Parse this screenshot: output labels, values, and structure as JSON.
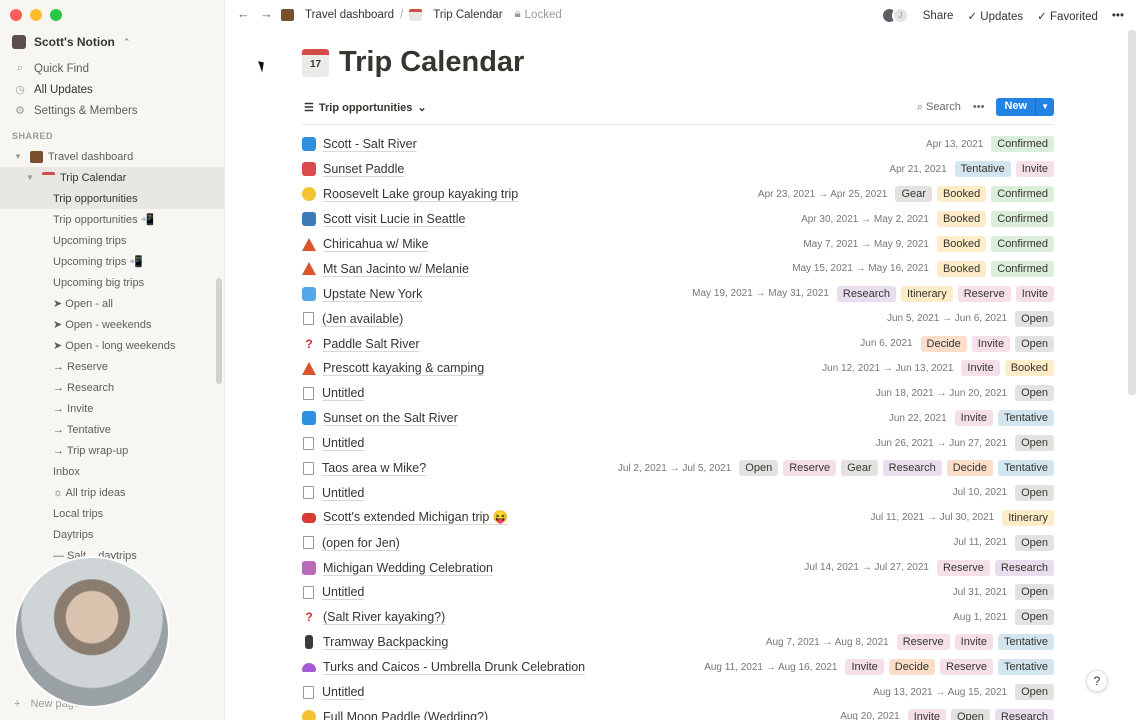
{
  "workspace": {
    "name": "Scott's Notion"
  },
  "sidebar": {
    "nav": [
      {
        "icon": "search-icon",
        "label": "Quick Find"
      },
      {
        "icon": "clock-icon",
        "label": "All Updates"
      },
      {
        "icon": "gear-icon",
        "label": "Settings & Members"
      }
    ],
    "shared_heading": "SHARED",
    "tree": [
      {
        "label": "Travel dashboard",
        "level": 1
      },
      {
        "label": "Trip Calendar",
        "level": 2
      },
      {
        "label": "Trip opportunities",
        "level": 3
      },
      {
        "label": "Trip opportunities 📲",
        "level": 3
      },
      {
        "label": "Upcoming trips",
        "level": 3
      },
      {
        "label": "Upcoming trips 📲",
        "level": 3
      },
      {
        "label": "Upcoming big trips",
        "level": 3
      },
      {
        "label": "➤ Open - all",
        "level": 3
      },
      {
        "label": "➤ Open - weekends",
        "level": 3
      },
      {
        "label": "➤ Open - long weekends",
        "level": 3
      },
      {
        "label": "→ Reserve",
        "level": 3
      },
      {
        "label": "→ Research",
        "level": 3
      },
      {
        "label": "→ Invite",
        "level": 3
      },
      {
        "label": "→ Tentative",
        "level": 3
      },
      {
        "label": "→ Trip wrap-up",
        "level": 3
      },
      {
        "label": "Inbox",
        "level": 3
      },
      {
        "label": "☼ All trip ideas",
        "level": 3
      },
      {
        "label": "Local trips",
        "level": 3
      },
      {
        "label": "Daytrips",
        "level": 3
      },
      {
        "label": "— Salt... daytrips",
        "level": 3
      }
    ],
    "new_page": "New page",
    "trips_fragment": "trips"
  },
  "topbar": {
    "breadcrumb_parent": "Travel dashboard",
    "breadcrumb_current": "Trip Calendar",
    "locked": "Locked",
    "share": "Share",
    "updates": "Updates",
    "favorited": "Favorited"
  },
  "page": {
    "title": "Trip Calendar",
    "title_icon_text": "17",
    "view_name": "Trip opportunities",
    "search_label": "Search",
    "new_label": "New"
  },
  "rows": [
    {
      "icon": "i-blue",
      "name": "Scott - Salt River",
      "date": "Apr 13, 2021",
      "tags": [
        "Confirmed"
      ]
    },
    {
      "icon": "i-red",
      "name": "Sunset Paddle",
      "date": "Apr 21, 2021",
      "tags": [
        "Tentative",
        "Invite"
      ]
    },
    {
      "icon": "i-sun",
      "name": "Roosevelt Lake group kayaking trip",
      "date": "Apr 23, 2021 → Apr 25, 2021",
      "tags": [
        "Gear",
        "Booked",
        "Confirmed"
      ]
    },
    {
      "icon": "i-city",
      "name": "Scott visit Lucie in Seattle",
      "date": "Apr 30, 2021 → May 2, 2021",
      "tags": [
        "Booked",
        "Confirmed"
      ]
    },
    {
      "icon": "i-tent",
      "name": "Chiricahua w/ Mike",
      "date": "May 7, 2021 → May 9, 2021",
      "tags": [
        "Booked",
        "Confirmed"
      ]
    },
    {
      "icon": "i-tent",
      "name": "Mt San Jacinto w/ Melanie",
      "date": "May 15, 2021 → May 16, 2021",
      "tags": [
        "Booked",
        "Confirmed"
      ]
    },
    {
      "icon": "i-plane",
      "name": "Upstate New York",
      "date": "May 19, 2021 → May 31, 2021",
      "tags": [
        "Research",
        "Itinerary",
        "Reserve",
        "Invite"
      ]
    },
    {
      "icon": "i-doc",
      "name": "(Jen available)",
      "date": "Jun 5, 2021 → Jun 6, 2021",
      "tags": [
        "Open"
      ]
    },
    {
      "icon": "i-q",
      "name": "Paddle Salt River",
      "date": "Jun 6, 2021",
      "tags": [
        "Decide",
        "Invite",
        "Open"
      ]
    },
    {
      "icon": "i-tent",
      "name": "Prescott kayaking & camping",
      "date": "Jun 12, 2021 → Jun 13, 2021",
      "tags": [
        "Invite",
        "Booked"
      ]
    },
    {
      "icon": "i-doc",
      "name": "Untitled",
      "date": "Jun 18, 2021 → Jun 20, 2021",
      "tags": [
        "Open"
      ]
    },
    {
      "icon": "i-blue",
      "name": "Sunset on the Salt River",
      "date": "Jun 22, 2021",
      "tags": [
        "Invite",
        "Tentative"
      ]
    },
    {
      "icon": "i-doc",
      "name": "Untitled",
      "date": "Jun 26, 2021 → Jun 27, 2021",
      "tags": [
        "Open"
      ]
    },
    {
      "icon": "i-doc",
      "name": "Taos area w Mike?",
      "date": "Jul 2, 2021 → Jul 5, 2021",
      "tags": [
        "Open",
        "Reserve",
        "Gear",
        "Research",
        "Decide",
        "Tentative"
      ]
    },
    {
      "icon": "i-doc",
      "name": "Untitled",
      "date": "Jul 10, 2021",
      "tags": [
        "Open"
      ]
    },
    {
      "icon": "i-car",
      "name": "Scott's extended Michigan trip 😝",
      "date": "Jul 11, 2021 → Jul 30, 2021",
      "tags": [
        "Itinerary"
      ]
    },
    {
      "icon": "i-doc",
      "name": "(open for Jen)",
      "date": "Jul 11, 2021",
      "tags": [
        "Open"
      ]
    },
    {
      "icon": "i-wed",
      "name": "Michigan Wedding Celebration",
      "date": "Jul 14, 2021 → Jul 27, 2021",
      "tags": [
        "Reserve",
        "Research"
      ]
    },
    {
      "icon": "i-doc",
      "name": "Untitled",
      "date": "Jul 31, 2021",
      "tags": [
        "Open"
      ]
    },
    {
      "icon": "i-q",
      "name": "(Salt River kayaking?)",
      "date": "Aug 1, 2021",
      "tags": [
        "Open"
      ]
    },
    {
      "icon": "i-tram",
      "name": "Tramway Backpacking",
      "date": "Aug 7, 2021 → Aug 8, 2021",
      "tags": [
        "Reserve",
        "Invite",
        "Tentative"
      ]
    },
    {
      "icon": "i-umb",
      "name": "Turks and Caicos - Umbrella Drunk Celebration",
      "date": "Aug 11, 2021 → Aug 16, 2021",
      "tags": [
        "Invite",
        "Decide",
        "Reserve",
        "Tentative"
      ]
    },
    {
      "icon": "i-doc",
      "name": "Untitled",
      "date": "Aug 13, 2021 → Aug 15, 2021",
      "tags": [
        "Open"
      ]
    },
    {
      "icon": "i-sun",
      "name": "Full Moon Paddle (Wedding?)",
      "date": "Aug 20, 2021",
      "tags": [
        "Invite",
        "Open",
        "Research"
      ]
    }
  ],
  "help_label": "?"
}
